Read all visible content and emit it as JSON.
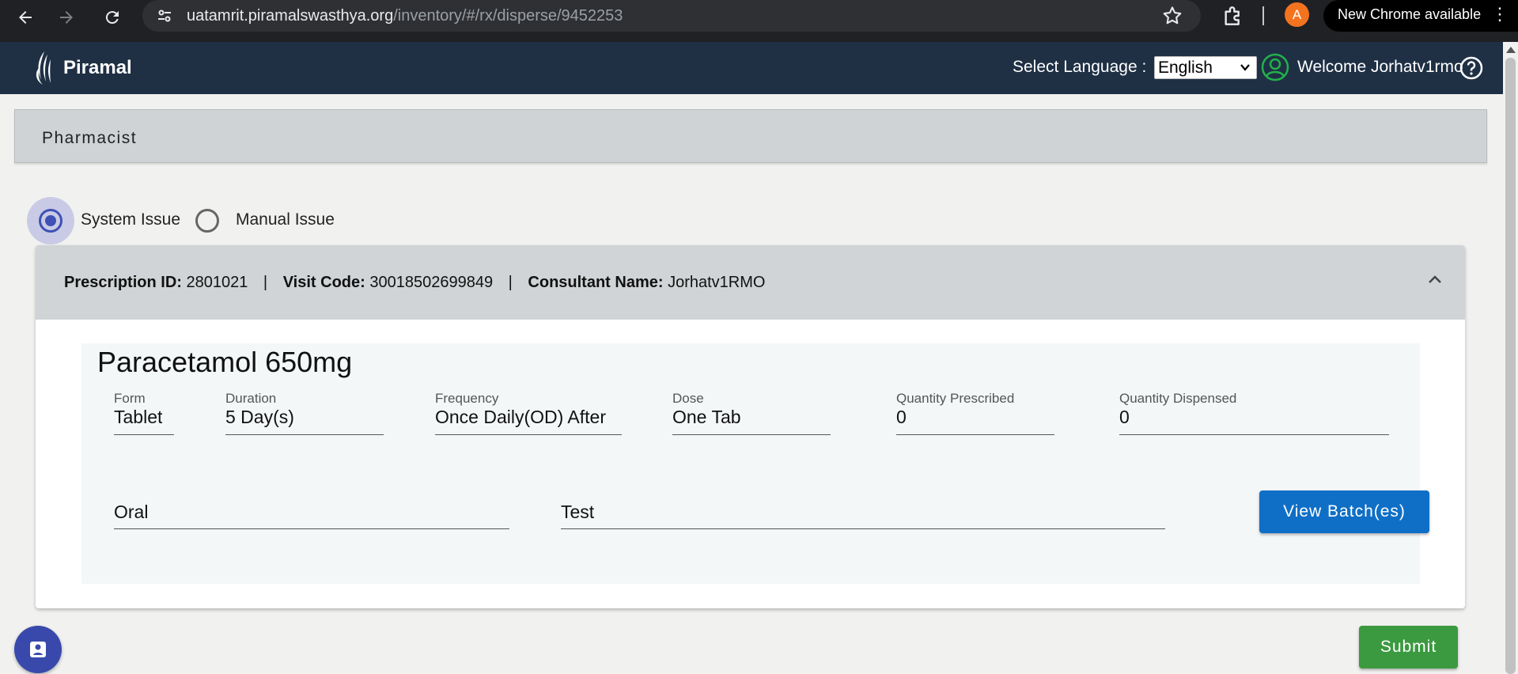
{
  "browser": {
    "url_host": "uatamrit.piramalswasthya.org",
    "url_path": "/inventory/#/rx/disperse/9452253",
    "profile_initial": "A",
    "update_text": "New Chrome available",
    "menu_glyph": "⋮"
  },
  "header": {
    "brand": "Piramal",
    "language_label": "Select Language :",
    "language_selected": "English",
    "welcome_text": "Welcome",
    "username": "Jorhatv1rmo"
  },
  "role_bar": {
    "title": "Pharmacist"
  },
  "issue_type": {
    "options": [
      {
        "label": "System Issue",
        "selected": true
      },
      {
        "label": "Manual Issue",
        "selected": false
      }
    ]
  },
  "prescription": {
    "id_label": "Prescription ID:",
    "id_value": "2801021",
    "visit_label": "Visit Code:",
    "visit_value": "30018502699849",
    "consultant_label": "Consultant Name:",
    "consultant_value": "Jorhatv1RMO",
    "separator": "|"
  },
  "drug": {
    "name": "Paracetamol 650mg",
    "fields": [
      {
        "label": "Form",
        "value": "Tablet"
      },
      {
        "label": "Duration",
        "value": "5 Day(s)"
      },
      {
        "label": "Frequency",
        "value": "Once Daily(OD) After"
      },
      {
        "label": "Dose",
        "value": "One Tab"
      },
      {
        "label": "Quantity Prescribed",
        "value": "0"
      },
      {
        "label": "Quantity Dispensed",
        "value": "0"
      }
    ],
    "route": "Oral",
    "instructions": "Test",
    "view_batch_label": "View Batch(es)"
  },
  "actions": {
    "submit_label": "Submit"
  },
  "colors": {
    "header_bg": "#1f3045",
    "primary": "#0f6fc6",
    "success": "#3b9a3f",
    "radio_accent": "#3f51b5"
  },
  "icons": [
    "back-arrow-icon",
    "forward-arrow-icon",
    "reload-icon",
    "site-info-icon",
    "star-icon",
    "extensions-icon",
    "user-circle-icon",
    "help-icon",
    "chevron-up-icon",
    "chat-contact-icon",
    "piramal-logo-icon"
  ]
}
